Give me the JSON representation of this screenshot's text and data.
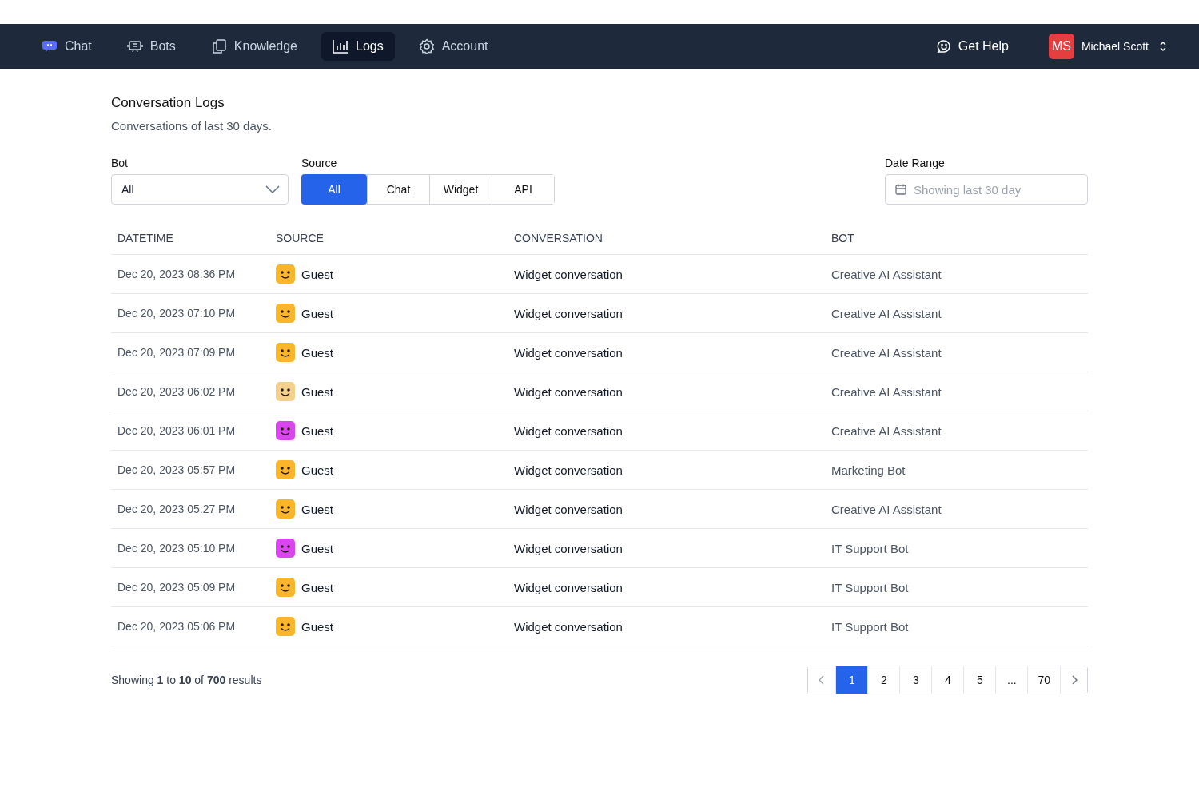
{
  "nav": {
    "items": [
      {
        "label": "Chat",
        "kind": "chat",
        "selected": false
      },
      {
        "label": "Bots",
        "kind": "bot",
        "selected": false
      },
      {
        "label": "Knowledge",
        "kind": "copy",
        "selected": false
      },
      {
        "label": "Logs",
        "kind": "chart",
        "selected": true
      },
      {
        "label": "Account",
        "kind": "gear",
        "selected": false
      }
    ],
    "help": "Get Help",
    "user": {
      "initials": "MS",
      "name": "Michael Scott"
    }
  },
  "header": {
    "title": "Conversation Logs",
    "subtitle": "Conversations of last 30 days."
  },
  "filters": {
    "bot": {
      "label": "Bot",
      "value": "All"
    },
    "source": {
      "label": "Source",
      "options": [
        {
          "label": "All",
          "selected": true
        },
        {
          "label": "Chat",
          "selected": false
        },
        {
          "label": "Widget",
          "selected": false
        },
        {
          "label": "API",
          "selected": false
        }
      ]
    },
    "date_range": {
      "label": "Date Range",
      "placeholder": "Showing last 30 day"
    }
  },
  "table": {
    "columns": [
      "DATETIME",
      "SOURCE",
      "CONVERSATION",
      "BOT"
    ],
    "rows": [
      {
        "datetime": "Dec 20, 2023 08:36 PM",
        "source": "Guest",
        "color": "#fbb52b",
        "conversation": "Widget conversation",
        "bot": "Creative AI Assistant"
      },
      {
        "datetime": "Dec 20, 2023 07:10 PM",
        "source": "Guest",
        "color": "#fbb52b",
        "conversation": "Widget conversation",
        "bot": "Creative AI Assistant"
      },
      {
        "datetime": "Dec 20, 2023 07:09 PM",
        "source": "Guest",
        "color": "#fbb52b",
        "conversation": "Widget conversation",
        "bot": "Creative AI Assistant"
      },
      {
        "datetime": "Dec 20, 2023 06:02 PM",
        "source": "Guest",
        "color": "#f3d08c",
        "conversation": "Widget conversation",
        "bot": "Creative AI Assistant"
      },
      {
        "datetime": "Dec 20, 2023 06:01 PM",
        "source": "Guest",
        "color": "#d946ef",
        "conversation": "Widget conversation",
        "bot": "Creative AI Assistant"
      },
      {
        "datetime": "Dec 20, 2023 05:57 PM",
        "source": "Guest",
        "color": "#fbb52b",
        "conversation": "Widget conversation",
        "bot": "Marketing Bot"
      },
      {
        "datetime": "Dec 20, 2023 05:27 PM",
        "source": "Guest",
        "color": "#fbb52b",
        "conversation": "Widget conversation",
        "bot": "Creative AI Assistant"
      },
      {
        "datetime": "Dec 20, 2023 05:10 PM",
        "source": "Guest",
        "color": "#d946ef",
        "conversation": "Widget conversation",
        "bot": "IT Support Bot"
      },
      {
        "datetime": "Dec 20, 2023 05:09 PM",
        "source": "Guest",
        "color": "#fbb52b",
        "conversation": "Widget conversation",
        "bot": "IT Support Bot"
      },
      {
        "datetime": "Dec 20, 2023 05:06 PM",
        "source": "Guest",
        "color": "#fbb52b",
        "conversation": "Widget conversation",
        "bot": "IT Support Bot"
      }
    ]
  },
  "footer": {
    "summary": "Showing **1** to **10** of **700** results",
    "pages": [
      {
        "label": "1",
        "selected": true
      },
      {
        "label": "2",
        "selected": false
      },
      {
        "label": "3",
        "selected": false
      },
      {
        "label": "4",
        "selected": false
      },
      {
        "label": "5",
        "selected": false
      },
      {
        "label": "...",
        "selected": false
      },
      {
        "label": "70",
        "selected": false
      }
    ]
  }
}
